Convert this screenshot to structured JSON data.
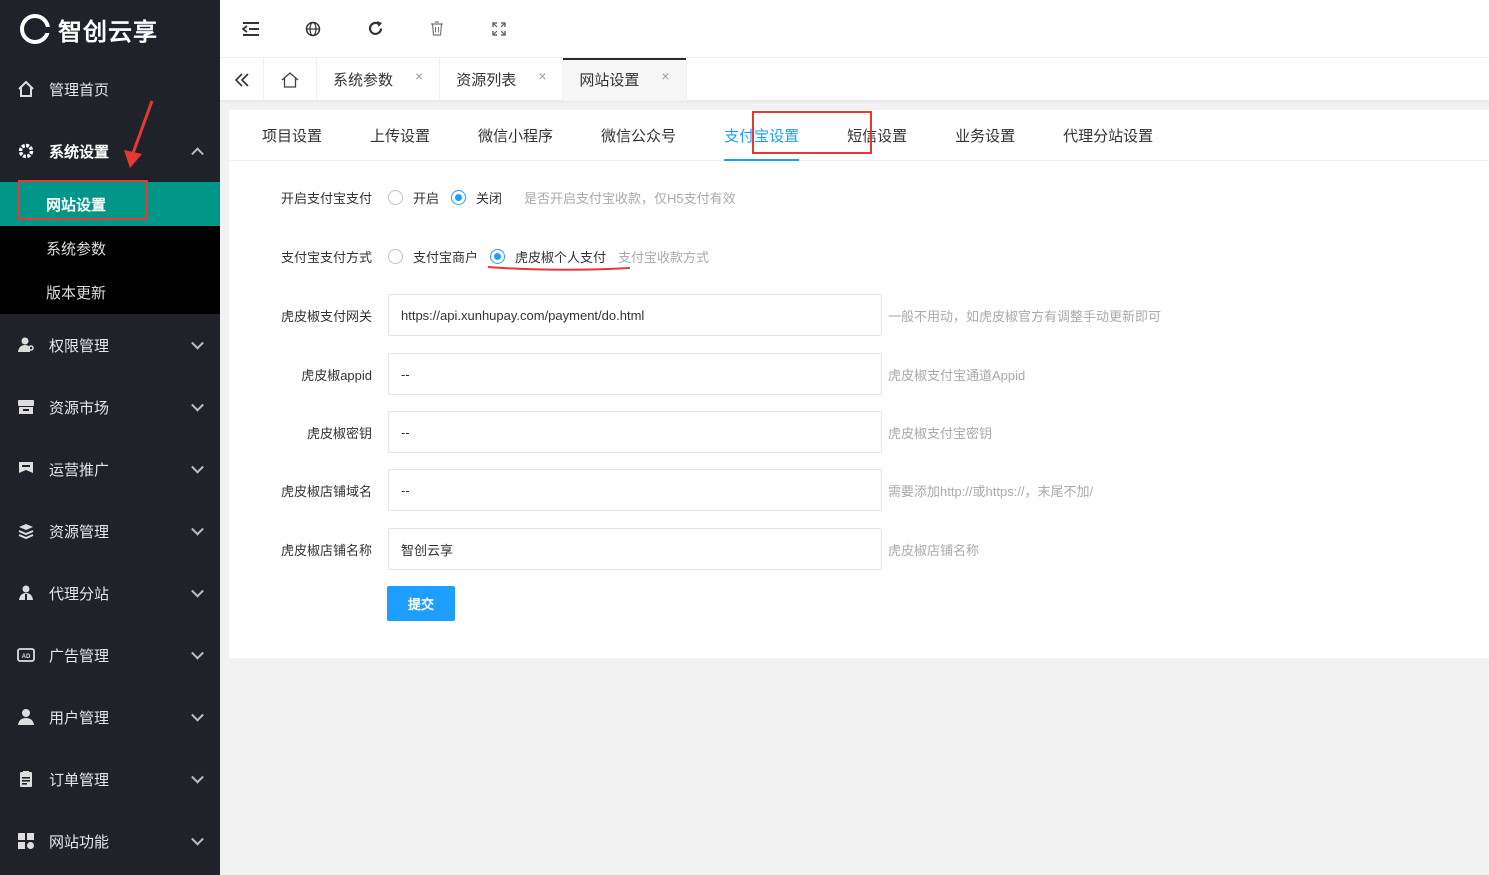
{
  "app": {
    "logo_text": "智创云享"
  },
  "sidebar": {
    "items": [
      {
        "label": "管理首页",
        "icon": "home-icon"
      },
      {
        "label": "系统设置",
        "icon": "gear-icon",
        "expanded": true,
        "children": [
          {
            "label": "网站设置",
            "active": true
          },
          {
            "label": "系统参数"
          },
          {
            "label": "版本更新"
          }
        ]
      },
      {
        "label": "权限管理",
        "icon": "user-key-icon"
      },
      {
        "label": "资源市场",
        "icon": "store-icon"
      },
      {
        "label": "运营推广",
        "icon": "flag-icon"
      },
      {
        "label": "资源管理",
        "icon": "layers-icon"
      },
      {
        "label": "代理分站",
        "icon": "group-icon"
      },
      {
        "label": "广告管理",
        "icon": "ad-icon"
      },
      {
        "label": "用户管理",
        "icon": "user-icon"
      },
      {
        "label": "订单管理",
        "icon": "order-icon"
      },
      {
        "label": "网站功能",
        "icon": "apps-icon"
      }
    ]
  },
  "page_tabs": [
    {
      "label": "系统参数",
      "close": "×"
    },
    {
      "label": "资源列表",
      "close": "×"
    },
    {
      "label": "网站设置",
      "close": "×",
      "active": true
    }
  ],
  "settings_tabs": [
    "项目设置",
    "上传设置",
    "微信小程序",
    "微信公众号",
    "支付宝设置",
    "短信设置",
    "业务设置",
    "代理分站设置"
  ],
  "active_settings_tab": "支付宝设置",
  "form": {
    "enable": {
      "label": "开启支付宝支付",
      "options": [
        "开启",
        "关闭"
      ],
      "selected": "关闭",
      "hint": "是否开启支付宝收款，仅H5支付有效"
    },
    "method": {
      "label": "支付宝支付方式",
      "options": [
        "支付宝商户",
        "虎皮椒个人支付"
      ],
      "selected": "虎皮椒个人支付",
      "hint": "支付宝收款方式"
    },
    "gateway": {
      "label": "虎皮椒支付网关",
      "value": "https://api.xunhupay.com/payment/do.html",
      "hint": "一般不用动，如虎皮椒官方有调整手动更新即可"
    },
    "appid": {
      "label": "虎皮椒appid",
      "value": "--",
      "hint": "虎皮椒支付宝通道Appid"
    },
    "secret": {
      "label": "虎皮椒密钥",
      "value": "--",
      "hint": "虎皮椒支付宝密钥"
    },
    "domain": {
      "label": "虎皮椒店铺域名",
      "value": "--",
      "hint": "需要添加http://或https://，末尾不加/"
    },
    "shop_name": {
      "label": "虎皮椒店铺名称",
      "value": "智创云享",
      "hint": "虎皮椒店铺名称"
    },
    "submit_label": "提交"
  },
  "colors": {
    "sidebar_bg": "#20222a",
    "active_green": "#009688",
    "accent_blue": "#1e9fff",
    "annotation_red": "#e53935"
  }
}
